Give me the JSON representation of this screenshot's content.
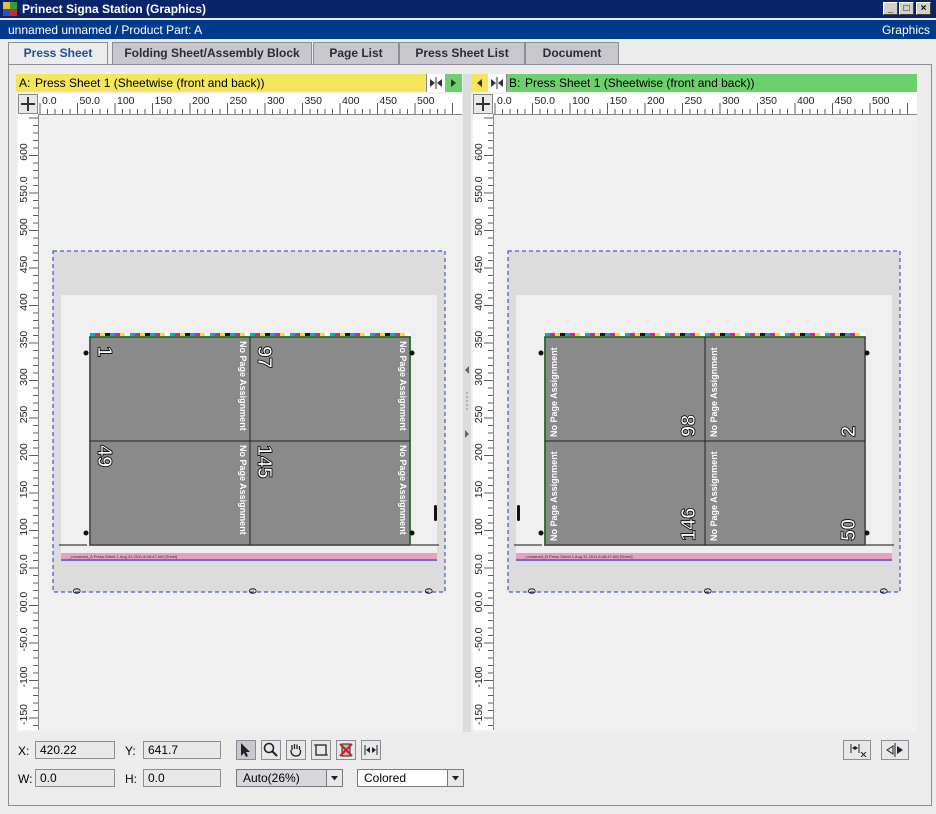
{
  "window": {
    "title": "Prinect Signa Station (Graphics)",
    "subtitle": "unnamed unnamed  / Product Part: A",
    "mode": "Graphics"
  },
  "tabs": [
    {
      "label": "Press Sheet",
      "active": true
    },
    {
      "label": "Folding Sheet/Assembly Block",
      "active": false
    },
    {
      "label": "Page List",
      "active": false
    },
    {
      "label": "Press Sheet List",
      "active": false
    },
    {
      "label": "Document",
      "active": false
    }
  ],
  "panels": {
    "a": {
      "prefix": "A:",
      "title": "Press Sheet 1 (Sheetwise (front and back))",
      "color": "#f4e65a",
      "pages": [
        {
          "number": "1",
          "label": "No Page Assignment"
        },
        {
          "number": "97",
          "label": "No Page Assignment"
        },
        {
          "number": "49",
          "label": "No Page Assignment"
        },
        {
          "number": "145",
          "label": "No Page Assignment"
        }
      ],
      "edge_marks": [
        "0",
        "0",
        "0"
      ],
      "slug_text": "_unnamed_A     Press Sheet 1     Aug 31 2011 8:46:47 AM     [Sheet]"
    },
    "b": {
      "prefix": "B:",
      "title": "Press Sheet 1 (Sheetwise (front and back))",
      "color": "#6cd06c",
      "pages": [
        {
          "number": "98",
          "label": "No Page Assignment"
        },
        {
          "number": "2",
          "label": "No Page Assignment"
        },
        {
          "number": "146",
          "label": "No Page Assignment"
        },
        {
          "number": "50",
          "label": "No Page Assignment"
        }
      ],
      "edge_marks": [
        "0",
        "0",
        "0"
      ],
      "slug_text": "_unnamed_B     Press Sheet 1     Aug 31 2011 8:46:47 AM     [Sheet]"
    }
  },
  "rulers": {
    "horizontal": [
      "0.0",
      "50.0",
      "100",
      "150",
      "200",
      "250",
      "300",
      "350",
      "400",
      "450",
      "500"
    ],
    "vertical": [
      "600",
      "550.0",
      "500",
      "450",
      "400",
      "350",
      "300",
      "250",
      "200",
      "150",
      "100",
      "50.0",
      "00.0",
      "-50.0",
      "-100",
      "-150"
    ]
  },
  "status": {
    "x_label": "X:",
    "x_value": "420.22",
    "y_label": "Y:",
    "y_value": "641.7",
    "w_label": "W:",
    "w_value": "0.0",
    "h_label": "H:",
    "h_value": "0.0",
    "zoom": "Auto(26%)",
    "display_mode": "Colored"
  },
  "tools": [
    "pointer-icon",
    "zoom-icon",
    "hand-icon",
    "crop-icon",
    "delete-marks-icon",
    "fit-width-icon",
    "fit-page-icon",
    "flip-sheet-icon"
  ]
}
